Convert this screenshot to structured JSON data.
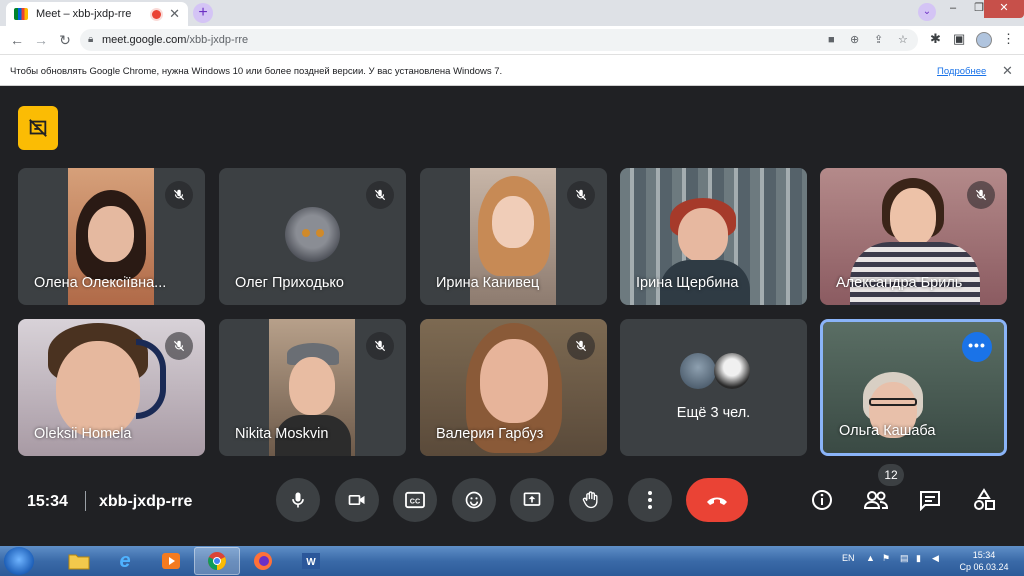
{
  "browser": {
    "tab_title": "Meet – xbb-jxdp-rre",
    "tab_close": "✕",
    "new_tab": "+",
    "url_host": "meet.google.com",
    "url_path": "/xbb-jxdp-rre",
    "window_controls": [
      "–",
      "❐",
      "✕"
    ]
  },
  "infobar": {
    "message": "Чтобы обновлять Google Chrome, нужна Windows 10 или более поздней версии. У вас установлена Windows 7.",
    "link": "Подробнее",
    "close": "✕"
  },
  "participants": [
    {
      "name": "Олена Олексіївна..."
    },
    {
      "name": "Олег Приходько"
    },
    {
      "name": "Ирина Канивец"
    },
    {
      "name": "Ірина Щербина"
    },
    {
      "name": "Александра Бриль"
    },
    {
      "name": "Oleksii Homela"
    },
    {
      "name": "Nikita Moskvin"
    },
    {
      "name": "Валерия Гарбуз"
    },
    {
      "name": "Ещё 3 чел."
    },
    {
      "name": "Ольга Кашаба"
    }
  ],
  "more_button": "•••",
  "meeting": {
    "time": "15:34",
    "code": "xbb-jxdp-rre",
    "participant_count": "12"
  },
  "taskbar": {
    "lang": "EN",
    "clock_time": "15:34",
    "clock_date": "Ср 06.03.24"
  },
  "colors": {
    "meet_bg": "#202124",
    "end_call": "#ea4335",
    "accent": "#1a73e8",
    "badge": "#fbbc04"
  }
}
